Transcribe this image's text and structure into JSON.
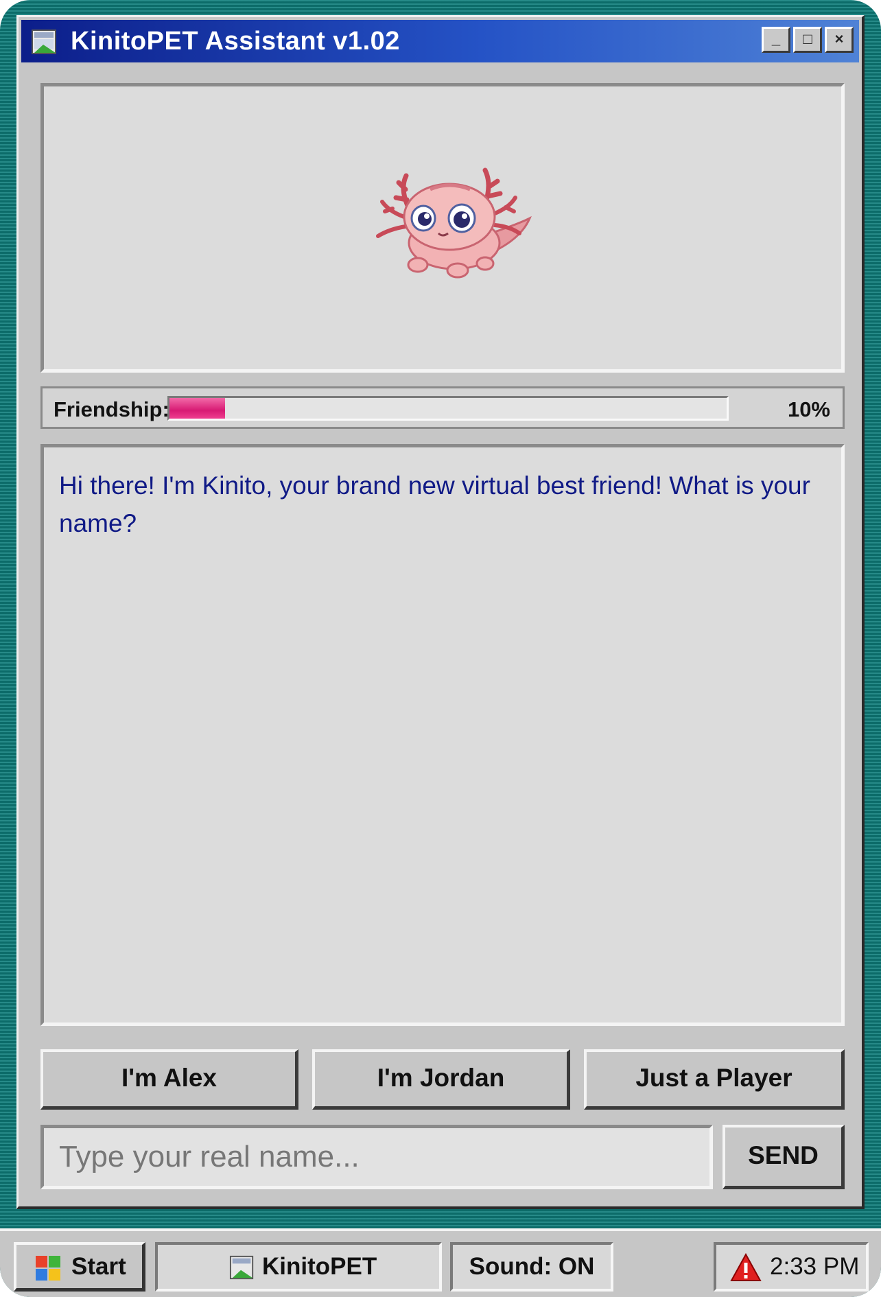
{
  "window": {
    "title": "KinitoPET Assistant v1.02",
    "minimize_label": "_",
    "maximize_label": "□",
    "close_label": "×"
  },
  "friendship": {
    "label": "Friendship:",
    "value_text": "10%",
    "progress": 0.1,
    "fill_color": "#e0227a"
  },
  "chat": {
    "message": "Hi there! I'm Kinito, your brand new virtual best friend! What is your name?",
    "text_color": "#101a86"
  },
  "choices": [
    "I'm Alex",
    "I'm Jordan",
    "Just a Player"
  ],
  "input": {
    "placeholder": "Type your real name...",
    "value": ""
  },
  "send_label": "SEND",
  "taskbar": {
    "start_label": "Start",
    "app_label": "KinitoPET",
    "sound_label": "Sound: ON",
    "clock": "2:33 PM"
  },
  "icons": {
    "window_icon": "app-icon",
    "pet": "axolotl-mascot",
    "warning": "warning-triangle-icon",
    "start": "windows-logo-icon"
  }
}
